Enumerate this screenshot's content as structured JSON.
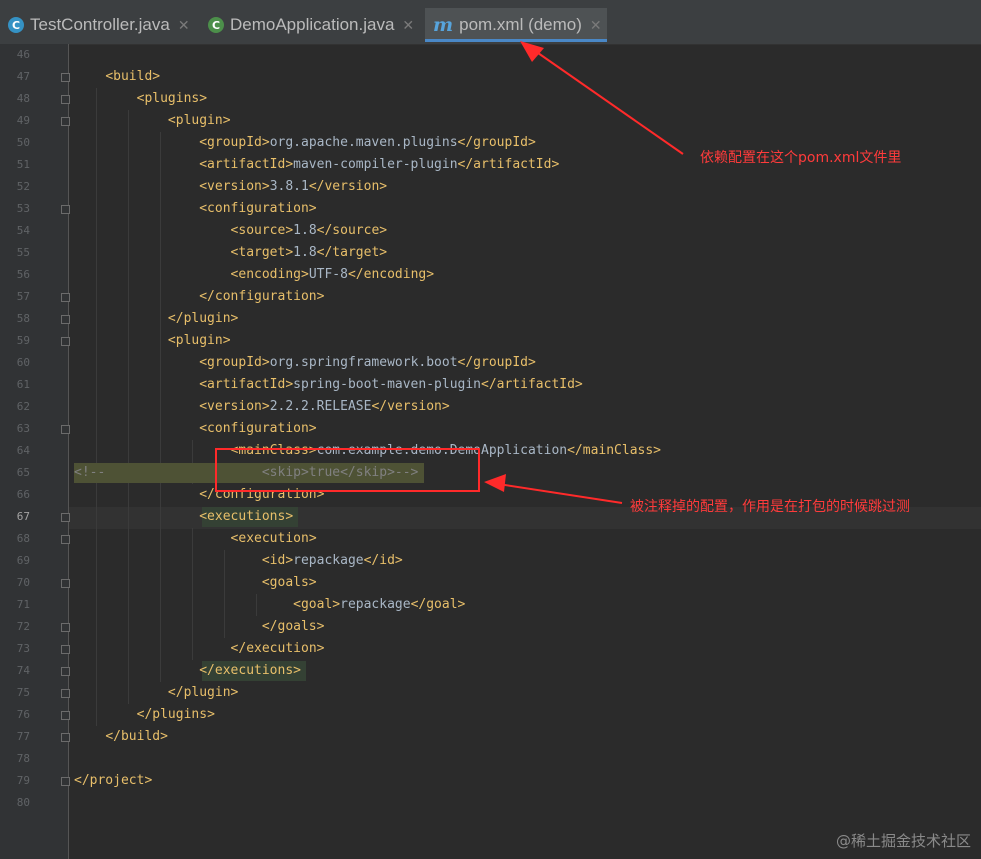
{
  "tabs": [
    {
      "label": "TestController.java",
      "icon": "java-class-icon",
      "active": false
    },
    {
      "label": "DemoApplication.java",
      "icon": "spring-class-icon",
      "active": false
    },
    {
      "label": "pom.xml (demo)",
      "icon": "maven-icon",
      "active": true
    }
  ],
  "editor": {
    "current_line": "67",
    "lines": [
      {
        "n": "46",
        "text": ""
      },
      {
        "n": "47",
        "text": "    <build>"
      },
      {
        "n": "48",
        "text": "        <plugins>"
      },
      {
        "n": "49",
        "text": "            <plugin>"
      },
      {
        "n": "50",
        "text": "                <groupId>org.apache.maven.plugins</groupId>"
      },
      {
        "n": "51",
        "text": "                <artifactId>maven-compiler-plugin</artifactId>"
      },
      {
        "n": "52",
        "text": "                <version>3.8.1</version>"
      },
      {
        "n": "53",
        "text": "                <configuration>"
      },
      {
        "n": "54",
        "text": "                    <source>1.8</source>"
      },
      {
        "n": "55",
        "text": "                    <target>1.8</target>"
      },
      {
        "n": "56",
        "text": "                    <encoding>UTF-8</encoding>"
      },
      {
        "n": "57",
        "text": "                </configuration>"
      },
      {
        "n": "58",
        "text": "            </plugin>"
      },
      {
        "n": "59",
        "text": "            <plugin>"
      },
      {
        "n": "60",
        "text": "                <groupId>org.springframework.boot</groupId>"
      },
      {
        "n": "61",
        "text": "                <artifactId>spring-boot-maven-plugin</artifactId>"
      },
      {
        "n": "62",
        "text": "                <version>2.2.2.RELEASE</version>"
      },
      {
        "n": "63",
        "text": "                <configuration>"
      },
      {
        "n": "64",
        "text": "                    <mainClass>com.example.demo.DemoApplication</mainClass>"
      },
      {
        "n": "65",
        "text": "<!--                    <skip>true</skip>-->"
      },
      {
        "n": "66",
        "text": "                </configuration>"
      },
      {
        "n": "67",
        "text": "                <executions>"
      },
      {
        "n": "68",
        "text": "                    <execution>"
      },
      {
        "n": "69",
        "text": "                        <id>repackage</id>"
      },
      {
        "n": "70",
        "text": "                        <goals>"
      },
      {
        "n": "71",
        "text": "                            <goal>repackage</goal>"
      },
      {
        "n": "72",
        "text": "                        </goals>"
      },
      {
        "n": "73",
        "text": "                    </execution>"
      },
      {
        "n": "74",
        "text": "                </executions>"
      },
      {
        "n": "75",
        "text": "            </plugin>"
      },
      {
        "n": "76",
        "text": "        </plugins>"
      },
      {
        "n": "77",
        "text": "    </build>"
      },
      {
        "n": "78",
        "text": ""
      },
      {
        "n": "79",
        "text": "</project>"
      },
      {
        "n": "80",
        "text": ""
      }
    ]
  },
  "annotations": {
    "pom_note": "依赖配置在这个pom.xml文件里",
    "skip_note": "被注释掉的配置，作用是在打包的时候跳过测",
    "color": "#ff2a2a"
  },
  "watermark": "@稀土掘金技术社区",
  "colors": {
    "tag": "#e8bf6a",
    "text": "#a9b7c6",
    "comment": "#808080",
    "background": "#2b2b2b"
  }
}
